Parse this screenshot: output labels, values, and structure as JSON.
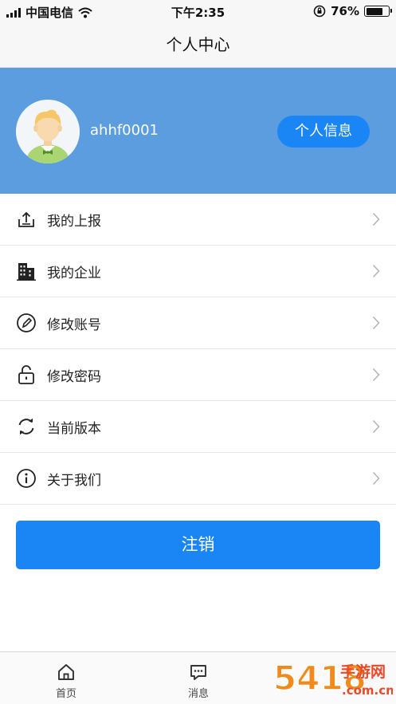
{
  "status_bar": {
    "carrier": "中国电信",
    "time": "下午2:35",
    "battery_percent": "76%",
    "battery_level": 0.76,
    "icons": [
      "signal-icon",
      "wifi-icon",
      "rotation-lock-icon",
      "battery-icon"
    ]
  },
  "header": {
    "title": "个人中心"
  },
  "profile": {
    "username": "ahhf0001",
    "info_button": "个人信息",
    "background_color": "#5b9ddf"
  },
  "menu": {
    "items": [
      {
        "label": "我的上报",
        "icon": "upload-icon"
      },
      {
        "label": "我的企业",
        "icon": "building-icon"
      },
      {
        "label": "修改账号",
        "icon": "edit-icon"
      },
      {
        "label": "修改密码",
        "icon": "lock-icon"
      },
      {
        "label": "当前版本",
        "icon": "refresh-icon"
      },
      {
        "label": "关于我们",
        "icon": "info-icon"
      }
    ]
  },
  "logout_button": "注销",
  "accent_color": "#1a85f4",
  "tabs": [
    {
      "label": "首页",
      "icon": "home-icon"
    },
    {
      "label": "消息",
      "icon": "message-icon"
    }
  ],
  "watermark": {
    "text": "手游网",
    "number": "5418",
    "domain": ".com.cn"
  }
}
